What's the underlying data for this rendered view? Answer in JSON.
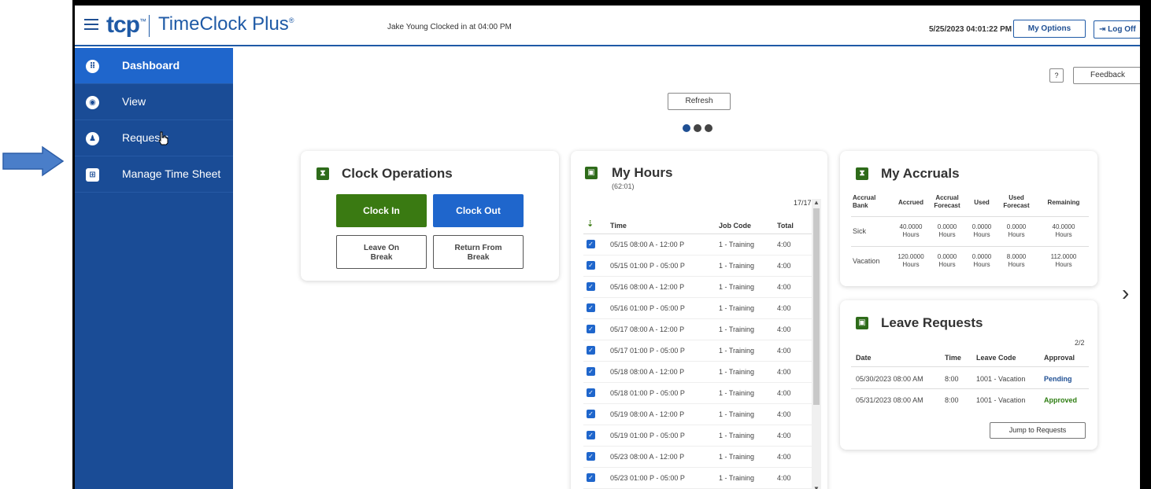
{
  "header": {
    "logo": "tcp",
    "logo_tm": "™",
    "product": "TimeClock Plus",
    "product_reg": "®",
    "clock_status": "Jake Young Clocked in at 04:00 PM",
    "datetime": "5/25/2023 04:01:22 PM",
    "options_label": "My Options",
    "logoff_label": "Log Off"
  },
  "sidebar": {
    "items": [
      {
        "label": "Dashboard",
        "icon": "grid-icon"
      },
      {
        "label": "View",
        "icon": "eye-icon"
      },
      {
        "label": "Requests",
        "icon": "user-plus-icon"
      },
      {
        "label": "Manage Time Sheet",
        "icon": "table-icon"
      }
    ]
  },
  "toolbar": {
    "help_label": "?",
    "feedback_label": "Feedback",
    "refresh_label": "Refresh"
  },
  "clock": {
    "title": "Clock Operations",
    "clock_in": "Clock In",
    "clock_out": "Clock Out",
    "leave_break_1": "Leave On",
    "leave_break_2": "Break",
    "return_break_1": "Return From",
    "return_break_2": "Break"
  },
  "hours": {
    "title": "My Hours",
    "subtitle": "(62:01)",
    "count": "17/17",
    "columns": [
      "Time",
      "Job Code",
      "Total"
    ],
    "rows": [
      {
        "time": "05/15 08:00 A - 12:00 P",
        "job": "1 - Training",
        "total": "4:00"
      },
      {
        "time": "05/15 01:00 P - 05:00 P",
        "job": "1 - Training",
        "total": "4:00"
      },
      {
        "time": "05/16 08:00 A - 12:00 P",
        "job": "1 - Training",
        "total": "4:00"
      },
      {
        "time": "05/16 01:00 P - 05:00 P",
        "job": "1 - Training",
        "total": "4:00"
      },
      {
        "time": "05/17 08:00 A - 12:00 P",
        "job": "1 - Training",
        "total": "4:00"
      },
      {
        "time": "05/17 01:00 P - 05:00 P",
        "job": "1 - Training",
        "total": "4:00"
      },
      {
        "time": "05/18 08:00 A - 12:00 P",
        "job": "1 - Training",
        "total": "4:00"
      },
      {
        "time": "05/18 01:00 P - 05:00 P",
        "job": "1 - Training",
        "total": "4:00"
      },
      {
        "time": "05/19 08:00 A - 12:00 P",
        "job": "1 - Training",
        "total": "4:00"
      },
      {
        "time": "05/19 01:00 P - 05:00 P",
        "job": "1 - Training",
        "total": "4:00"
      },
      {
        "time": "05/23 08:00 A - 12:00 P",
        "job": "1 - Training",
        "total": "4:00"
      },
      {
        "time": "05/23 01:00 P - 05:00 P",
        "job": "1 - Training",
        "total": "4:00"
      }
    ]
  },
  "accruals": {
    "title": "My Accruals",
    "head": {
      "bank_1": "Accrual",
      "bank_2": "Bank",
      "accrued": "Accrued",
      "af_1": "Accrual",
      "af_2": "Forecast",
      "used": "Used",
      "uf_1": "Used",
      "uf_2": "Forecast",
      "remaining": "Remaining"
    },
    "rows": [
      {
        "bank": "Sick",
        "accrued": "40.0000",
        "af": "0.0000",
        "used": "0.0000",
        "uf": "0.0000",
        "remaining": "40.0000",
        "unit": "Hours"
      },
      {
        "bank": "Vacation",
        "accrued": "120.0000",
        "af": "0.0000",
        "used": "0.0000",
        "uf": "8.0000",
        "remaining": "112.0000",
        "unit": "Hours"
      }
    ]
  },
  "leave": {
    "title": "Leave Requests",
    "count": "2/2",
    "columns": [
      "Date",
      "Time",
      "Leave Code",
      "Approval"
    ],
    "rows": [
      {
        "date": "05/30/2023 08:00 AM",
        "time": "8:00",
        "code": "1001 - Vacation",
        "approval": "Pending"
      },
      {
        "date": "05/31/2023 08:00 AM",
        "time": "8:00",
        "code": "1001 - Vacation",
        "approval": "Approved"
      }
    ],
    "jump_label": "Jump to Requests"
  },
  "colors": {
    "brand_blue": "#1a4c96",
    "active_blue": "#1f66cc",
    "green": "#3a7a12",
    "pending": "#1f4f93",
    "approved": "#2e7d12"
  }
}
